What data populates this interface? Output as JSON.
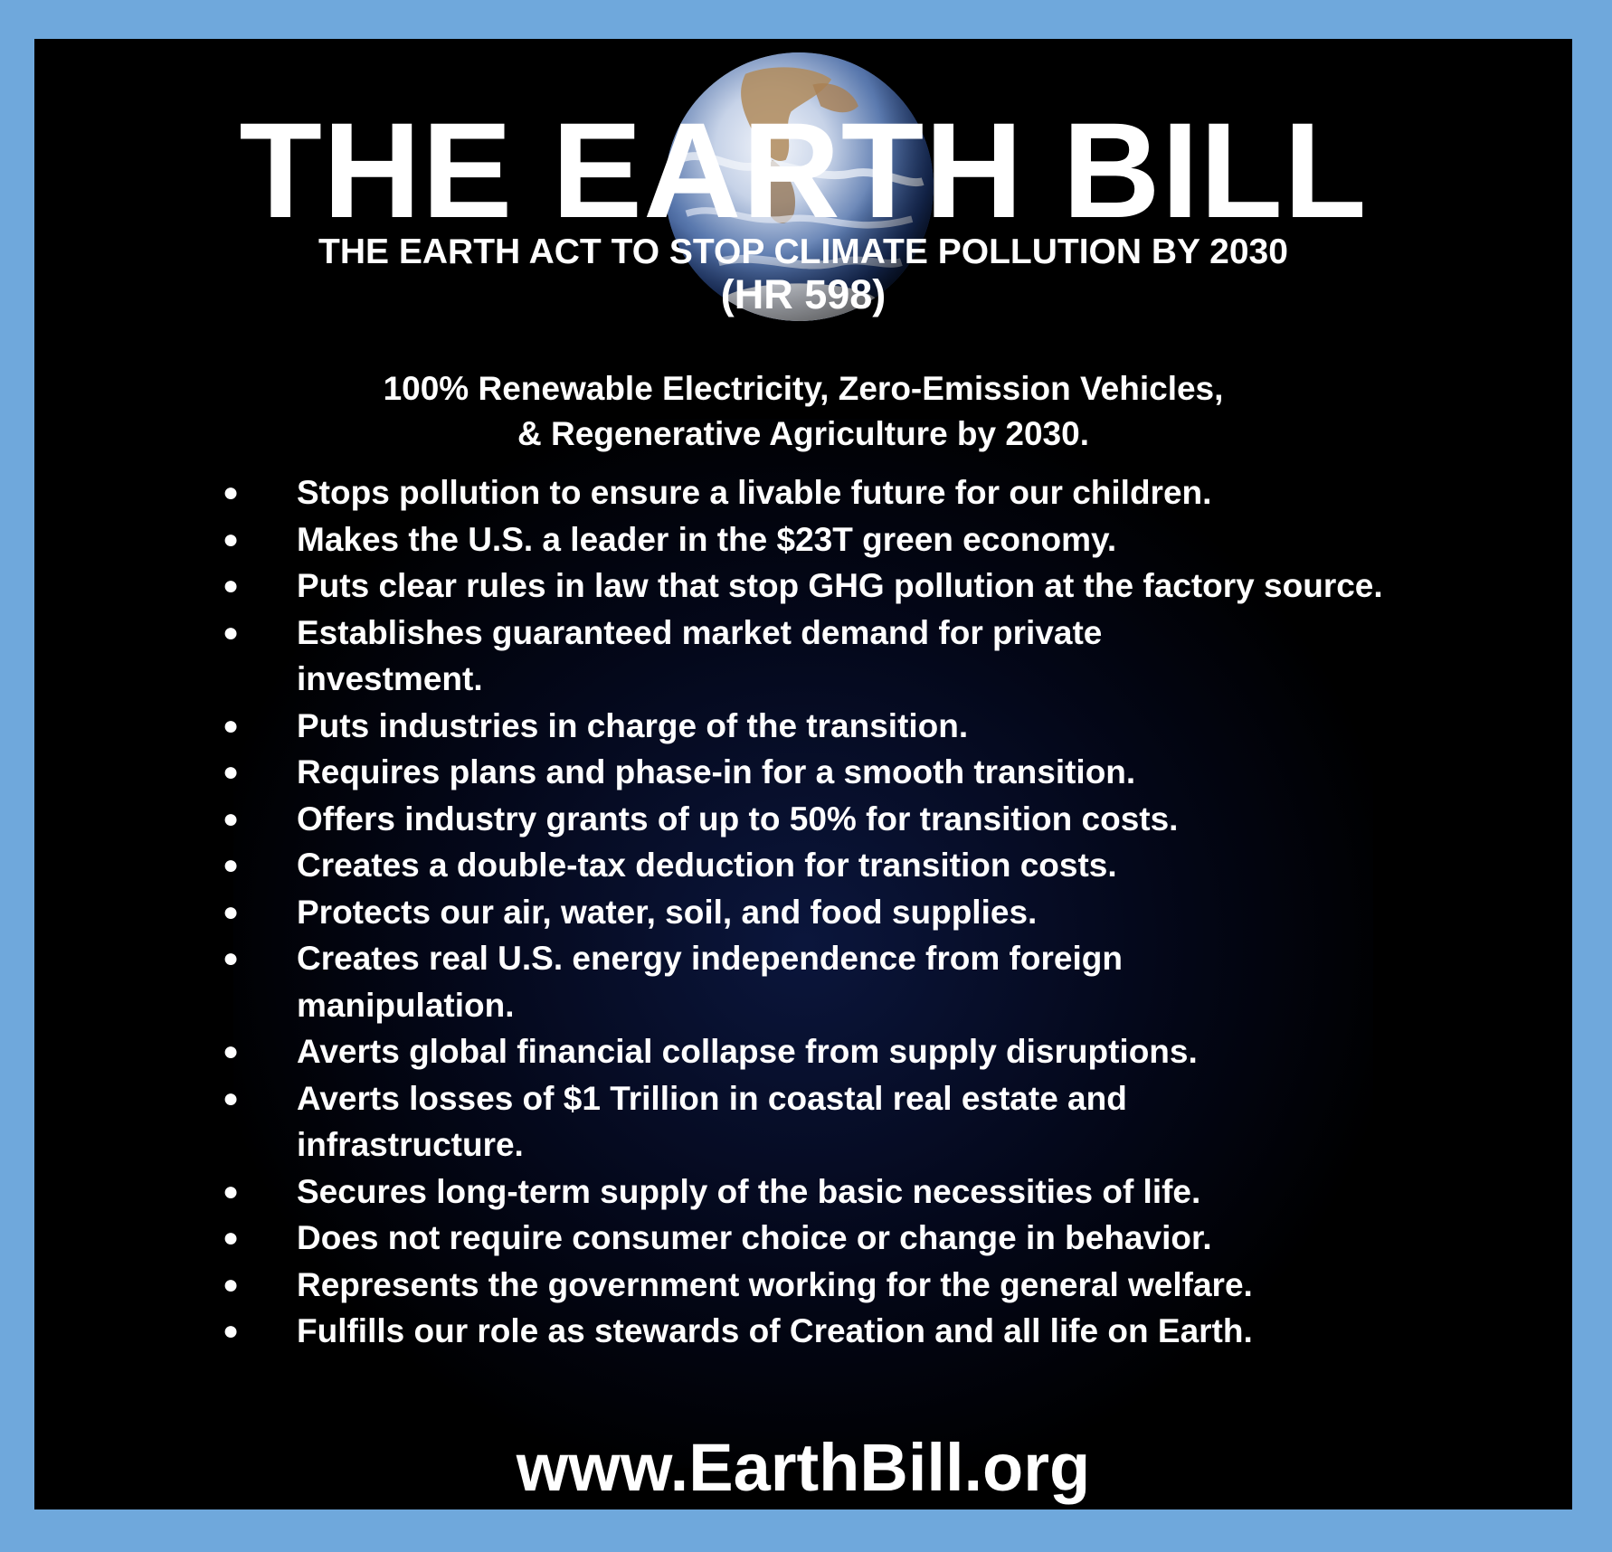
{
  "colors": {
    "frame": "#6fa8dc",
    "background": "#000000",
    "text": "#ffffff"
  },
  "poster": {
    "title": "THE EARTH BILL",
    "subtitle": "THE EARTH ACT TO STOP CLIMATE POLLUTION BY 2030",
    "bill_number": "(HR 598)",
    "tagline": [
      "100% Renewable Electricity, Zero-Emission Vehicles,",
      "& Regenerative Agriculture by 2030."
    ],
    "bullet_glyph": "●",
    "benefits": [
      "Stops pollution to ensure a livable future for our children.",
      "Makes the U.S. a leader in the $23T green economy.",
      "Puts clear rules in law that stop GHG pollution at the factory source.",
      "Establishes guaranteed market demand for private investment.",
      "Puts industries in charge of the transition.",
      "Requires plans and phase-in for a smooth transition.",
      "Offers industry grants of up to 50% for transition costs.",
      "Creates a double-tax deduction for transition costs.",
      "Protects our air, water, soil, and food supplies.",
      "Creates real U.S. energy independence from foreign manipulation.",
      "Averts global financial collapse from supply disruptions.",
      "Averts losses of $1 Trillion in coastal real estate and infrastructure.",
      "Secures long-term supply of the basic necessities of life.",
      "Does not require consumer choice or change in behavior.",
      "Represents the government working for the general welfare.",
      "Fulfills our role as stewards of Creation and all life on Earth."
    ],
    "website": "www.EarthBill.org",
    "image": "earth-globe"
  }
}
